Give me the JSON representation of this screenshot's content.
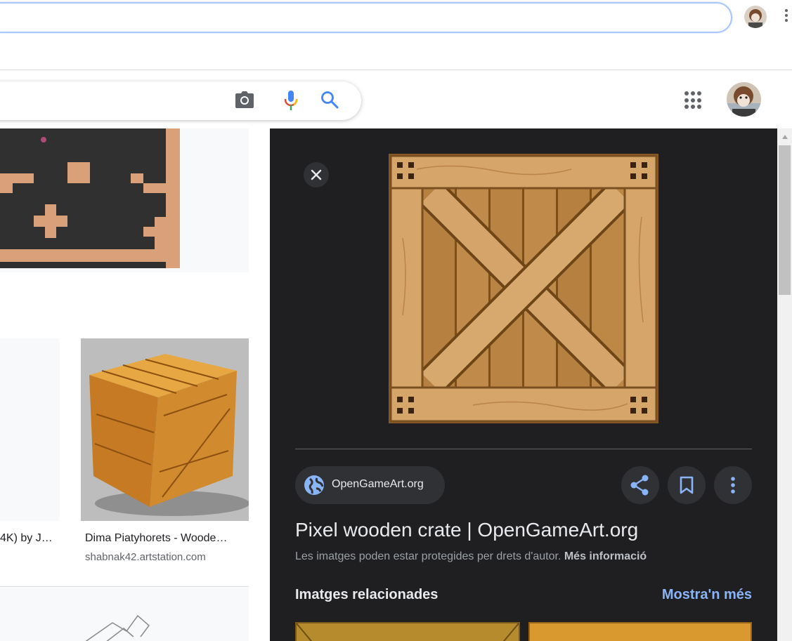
{
  "browser": {
    "address_value": "",
    "menu_icon": "vertical-dots-icon"
  },
  "search": {
    "query": "",
    "icons": [
      "camera-icon",
      "mic-icon",
      "search-icon"
    ]
  },
  "header": {
    "apps_icon": "apps-grid-icon"
  },
  "results": {
    "items": [
      {
        "title": "4K) by J…",
        "domain": ""
      },
      {
        "title": "Dima Piatyhorets - Woode…",
        "domain": "shabnak42.artstation.com"
      }
    ]
  },
  "panel": {
    "source_label": "OpenGameArt.org",
    "title": "Pixel wooden crate | OpenGameArt.org",
    "copyright_text": "Les imatges poden estar protegides per drets d'autor. ",
    "more_info_label": "Més informació",
    "related_title": "Imatges relacionades",
    "show_more_label": "Mostra'n més"
  },
  "colors": {
    "panel_bg": "#1f1f21",
    "link_blue": "#8ab4f8",
    "chip_bg": "#303134"
  }
}
